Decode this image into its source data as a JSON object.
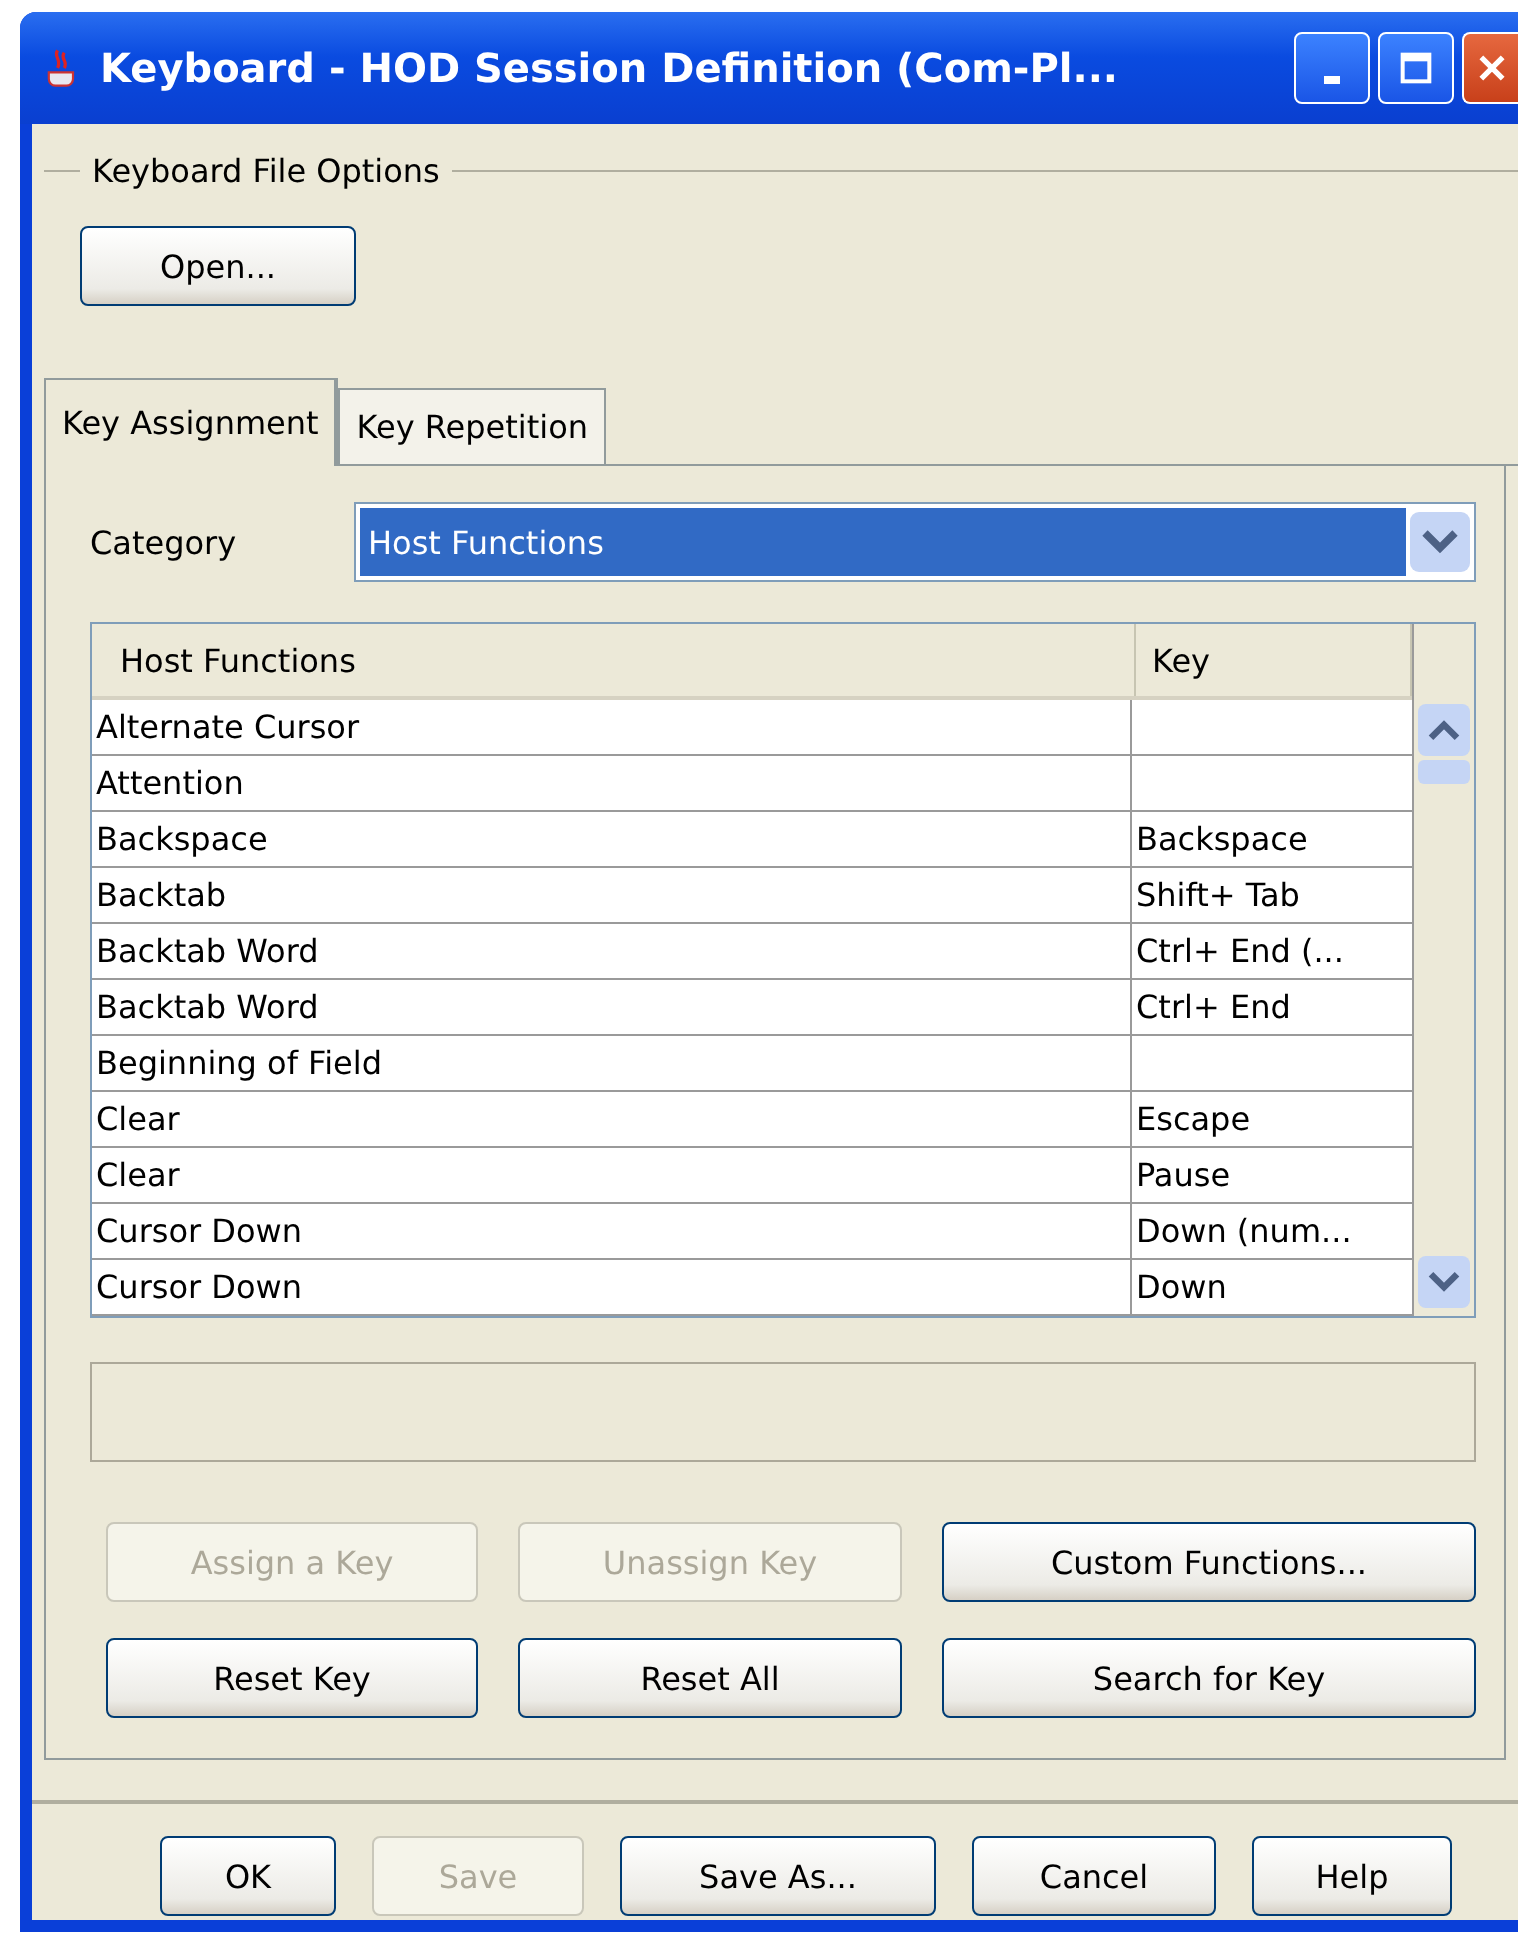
{
  "window": {
    "title": "Keyboard - HOD Session Definition (Com-Pl..."
  },
  "file_options": {
    "title": "Keyboard File Options",
    "open_button": "Open..."
  },
  "tabs": [
    {
      "label": "Key Assignment",
      "selected": true
    },
    {
      "label": "Key Repetition",
      "selected": false
    }
  ],
  "category": {
    "label": "Category",
    "value": "Host Functions"
  },
  "table": {
    "columns": [
      "Host Functions",
      "Key"
    ],
    "rows": [
      [
        "Alternate Cursor",
        ""
      ],
      [
        "Attention",
        ""
      ],
      [
        "Backspace",
        "Backspace"
      ],
      [
        "Backtab",
        "Shift+ Tab"
      ],
      [
        "Backtab Word",
        "Ctrl+ End (..."
      ],
      [
        "Backtab Word",
        "Ctrl+ End"
      ],
      [
        "Beginning of Field",
        ""
      ],
      [
        "Clear",
        "Escape"
      ],
      [
        "Clear",
        "Pause"
      ],
      [
        "Cursor Down",
        "Down (num..."
      ],
      [
        "Cursor Down",
        "Down"
      ]
    ]
  },
  "action_buttons": [
    {
      "label": "Assign a Key",
      "disabled": true
    },
    {
      "label": "Unassign Key",
      "disabled": true
    },
    {
      "label": "Custom Functions...",
      "disabled": false
    },
    {
      "label": "Reset Key",
      "disabled": false
    },
    {
      "label": "Reset All",
      "disabled": false
    },
    {
      "label": "Search for Key",
      "disabled": false
    }
  ],
  "dialog_buttons": [
    {
      "label": "OK",
      "disabled": false
    },
    {
      "label": "Save",
      "disabled": true
    },
    {
      "label": "Save As...",
      "disabled": false
    },
    {
      "label": "Cancel",
      "disabled": false
    },
    {
      "label": "Help",
      "disabled": false
    }
  ]
}
